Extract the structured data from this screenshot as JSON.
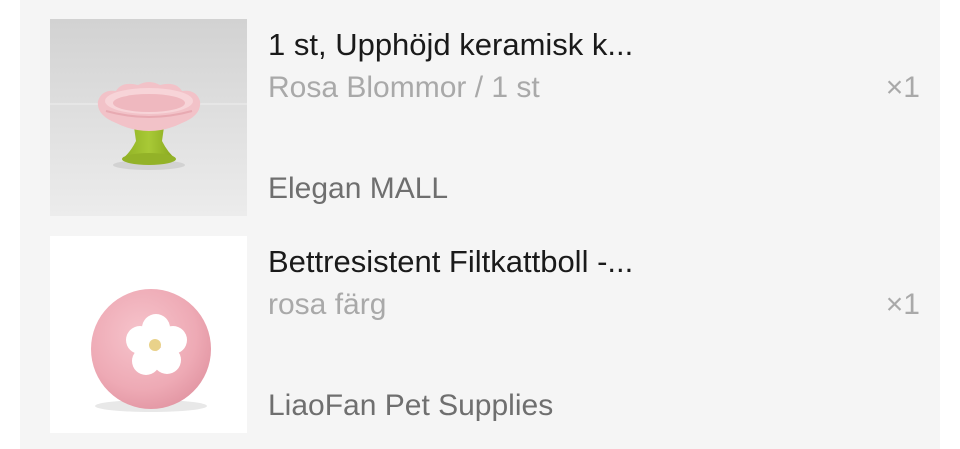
{
  "cart": {
    "items": [
      {
        "title": "1 st, Upphöjd keramisk k...",
        "variant": "Rosa Blommor / 1 st",
        "quantity": "×1",
        "store": "Elegan MALL",
        "image_icon": "ceramic-flower-bowl-icon"
      },
      {
        "title": "Bettresistent Filtkattboll -...",
        "variant": "rosa färg",
        "quantity": "×1",
        "store": "LiaoFan Pet Supplies",
        "image_icon": "felt-cat-ball-icon"
      }
    ]
  },
  "colors": {
    "panel_background": "#f5f5f5",
    "title_text": "#1a1a1a",
    "secondary_text": "#a9a9a9",
    "store_text": "#6f6f6f"
  }
}
